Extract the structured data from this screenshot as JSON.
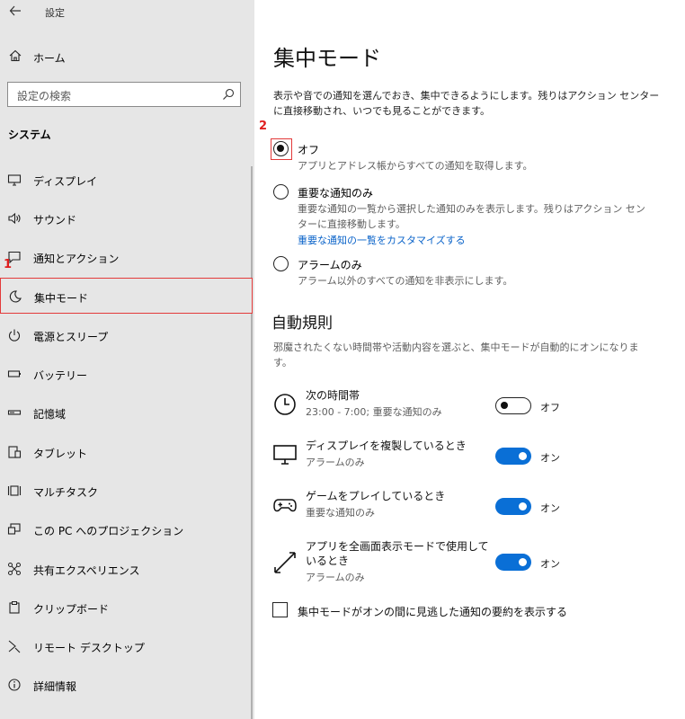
{
  "window": {
    "title": "設定"
  },
  "sidebar": {
    "home_label": "ホーム",
    "search_placeholder": "設定の検索",
    "section_title": "システム",
    "items": [
      {
        "label": "ディスプレイ",
        "icon": "monitor-icon"
      },
      {
        "label": "サウンド",
        "icon": "speaker-icon"
      },
      {
        "label": "通知とアクション",
        "icon": "notification-icon"
      },
      {
        "label": "集中モード",
        "icon": "moon-icon",
        "selected": true
      },
      {
        "label": "電源とスリープ",
        "icon": "power-icon"
      },
      {
        "label": "バッテリー",
        "icon": "battery-icon"
      },
      {
        "label": "記憶域",
        "icon": "storage-icon"
      },
      {
        "label": "タブレット",
        "icon": "tablet-icon"
      },
      {
        "label": "マルチタスク",
        "icon": "multitask-icon"
      },
      {
        "label": "この PC へのプロジェクション",
        "icon": "projection-icon"
      },
      {
        "label": "共有エクスペリエンス",
        "icon": "shared-icon"
      },
      {
        "label": "クリップボード",
        "icon": "clipboard-icon"
      },
      {
        "label": "リモート デスクトップ",
        "icon": "remote-icon"
      },
      {
        "label": "詳細情報",
        "icon": "info-icon"
      }
    ]
  },
  "markers": {
    "one": "1",
    "two": "2"
  },
  "main": {
    "title": "集中モード",
    "description": "表示や音での通知を選んでおき、集中できるようにします。残りはアクション センターに直接移動され、いつでも見ることができます。",
    "options": [
      {
        "title": "オフ",
        "desc": "アプリとアドレス帳からすべての通知を取得します。",
        "checked": true
      },
      {
        "title": "重要な通知のみ",
        "desc": "重要な通知の一覧から選択した通知のみを表示します。残りはアクション センターに直接移動します。",
        "link": "重要な通知の一覧をカスタマイズする",
        "checked": false
      },
      {
        "title": "アラームのみ",
        "desc": "アラーム以外のすべての通知を非表示にします。",
        "checked": false
      }
    ],
    "auto_rules": {
      "title": "自動規則",
      "description": "邪魔されたくない時間帯や活動内容を選ぶと、集中モードが自動的にオンになります。",
      "rules": [
        {
          "title": "次の時間帯",
          "sub": "23:00 - 7:00; 重要な通知のみ",
          "state": "オフ",
          "on": false,
          "icon": "clock-icon"
        },
        {
          "title": "ディスプレイを複製しているとき",
          "sub": "アラームのみ",
          "state": "オン",
          "on": true,
          "icon": "display-icon"
        },
        {
          "title": "ゲームをプレイしているとき",
          "sub": "重要な通知のみ",
          "state": "オン",
          "on": true,
          "icon": "gamepad-icon"
        },
        {
          "title": "アプリを全画面表示モードで使用しているとき",
          "sub": "アラームのみ",
          "state": "オン",
          "on": true,
          "icon": "fullscreen-icon"
        }
      ]
    },
    "summary_checkbox": "集中モードがオンの間に見逃した通知の要約を表示する"
  }
}
